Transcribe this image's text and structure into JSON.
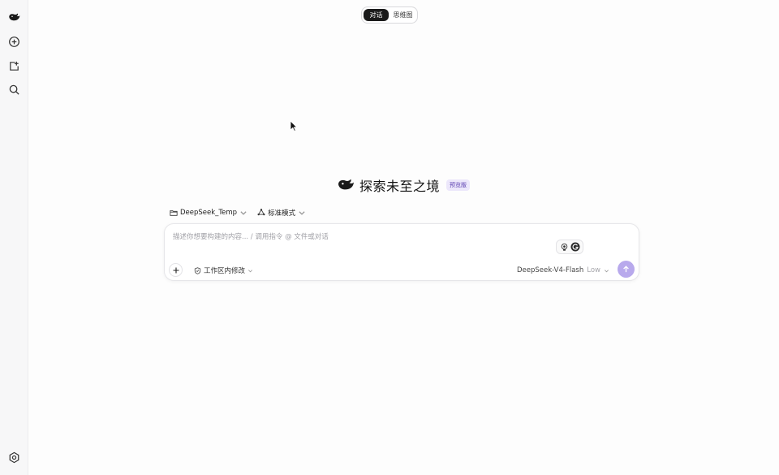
{
  "header": {
    "tabs": [
      {
        "label": "对话",
        "active": true
      },
      {
        "label": "思维图",
        "active": false
      }
    ]
  },
  "sidebar": {
    "icons": [
      "logo-icon",
      "new-chat-icon",
      "import-icon",
      "search-icon",
      "settings-icon"
    ]
  },
  "hero": {
    "title": "探索未至之境",
    "badge": "预览版"
  },
  "selectors": {
    "folder": "DeepSeek_Temp",
    "mode": "标准模式"
  },
  "composer": {
    "placeholder": "描述你想要构建的内容... / 调用指令 @ 文件或对话",
    "value": "",
    "workspace_label": "工作区内修改",
    "model_name": "DeepSeek-V4-Flash",
    "model_level": "Low"
  },
  "colors": {
    "accent": "#b8a9ec",
    "badge_bg": "#ece7fb",
    "badge_text": "#5b3fb0",
    "active_tab": "#1a1a1a"
  }
}
